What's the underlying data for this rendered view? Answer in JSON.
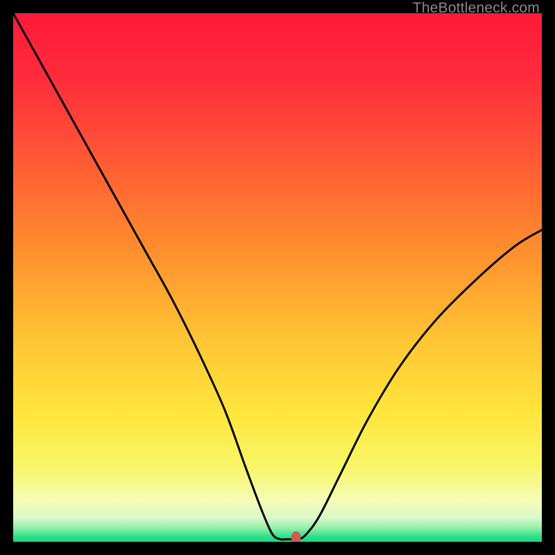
{
  "watermark": "TheBottleneck.com",
  "chart_data": {
    "type": "line",
    "title": "",
    "xlabel": "",
    "ylabel": "",
    "xlim": [
      0,
      100
    ],
    "ylim": [
      0,
      100
    ],
    "gradient_stops": [
      {
        "offset": 0.0,
        "color": "#ff1a3a"
      },
      {
        "offset": 0.12,
        "color": "#ff2b3c"
      },
      {
        "offset": 0.28,
        "color": "#ff5a35"
      },
      {
        "offset": 0.45,
        "color": "#ff8f2e"
      },
      {
        "offset": 0.62,
        "color": "#ffc634"
      },
      {
        "offset": 0.76,
        "color": "#ffe63c"
      },
      {
        "offset": 0.86,
        "color": "#f7f66a"
      },
      {
        "offset": 0.92,
        "color": "#f6fbb4"
      },
      {
        "offset": 0.955,
        "color": "#d9f8c8"
      },
      {
        "offset": 0.975,
        "color": "#8ceea9"
      },
      {
        "offset": 0.99,
        "color": "#2fe08a"
      },
      {
        "offset": 1.0,
        "color": "#16d97f"
      }
    ],
    "series": [
      {
        "name": "bottleneck-curve",
        "x": [
          0,
          5,
          10,
          15,
          20,
          25,
          30,
          35,
          40,
          44,
          47,
          49,
          50.5,
          52,
          54,
          55.5,
          58,
          62,
          67,
          73,
          80,
          88,
          95,
          100
        ],
        "y": [
          100,
          91,
          82,
          73,
          64,
          55,
          46,
          36,
          25,
          14,
          6,
          1.5,
          0.5,
          0.5,
          0.5,
          1.5,
          5,
          13,
          23,
          33,
          42,
          50,
          56,
          59
        ]
      }
    ],
    "marker": {
      "x": 53.5,
      "y": 0.8,
      "color": "#ce5c4e"
    }
  }
}
